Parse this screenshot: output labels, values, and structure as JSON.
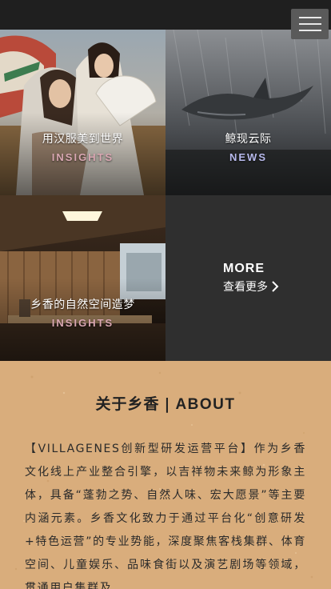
{
  "header": {
    "menu_icon": "hamburger-icon"
  },
  "tiles": [
    {
      "title": "用汉服美到世界",
      "tag": "INSIGHTS",
      "tag_color": "#d9a7b2"
    },
    {
      "title": "鲸现云际",
      "tag": "NEWS",
      "tag_color": "#b7b9ec"
    },
    {
      "title": "乡香的自然空间造梦",
      "tag": "INSIGHTS",
      "tag_color": "#d9a7b2"
    }
  ],
  "more": {
    "title": "MORE",
    "link": "查看更多",
    "arrow_icon": "chevron-right-icon"
  },
  "about": {
    "title_cn": "关于乡香",
    "separator": "|",
    "title_en": "ABOUT",
    "text": "【VILLAGENES创新型研发运营平台】作为乡香文化线上产业整合引擎，以吉祥物未来鲸为形象主体，具备“蓬勃之势、自然人味、宏大愿景”等主要内涵元素。乡香文化致力于通过平台化“创意研发+特色运营”的专业势能，深度聚焦客栈集群、体育空间、儿童娱乐、品味食街以及演艺剧场等领域，贯通用户集群及"
  },
  "colors": {
    "topbar": "#1f1f1f",
    "more_bg": "#2f2f2f",
    "paper": "#d9ad7c"
  }
}
